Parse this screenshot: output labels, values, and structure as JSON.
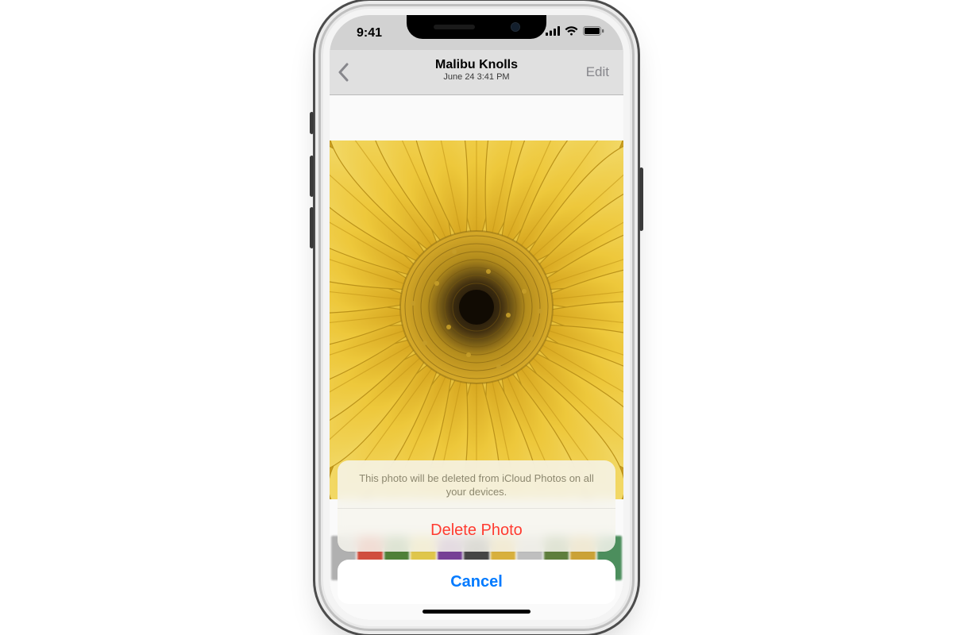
{
  "status": {
    "time": "9:41"
  },
  "nav": {
    "title": "Malibu Knolls",
    "subtitle": "June 24  3:41 PM",
    "edit_label": "Edit"
  },
  "photo": {
    "subject": "yellow-flower-closeup"
  },
  "thumbs": {
    "swatches": [
      "#b0b0b0",
      "#c94a3a",
      "#4b7b35",
      "#e0c850",
      "#6e3a8c",
      "#3e3e3e",
      "#d8b040",
      "#c0c0c0",
      "#5a7a3a",
      "#caa23a",
      "#4a8a5a"
    ]
  },
  "sheet": {
    "message": "This photo will be deleted from iCloud Photos on all your devices.",
    "delete_label": "Delete Photo",
    "cancel_label": "Cancel"
  }
}
